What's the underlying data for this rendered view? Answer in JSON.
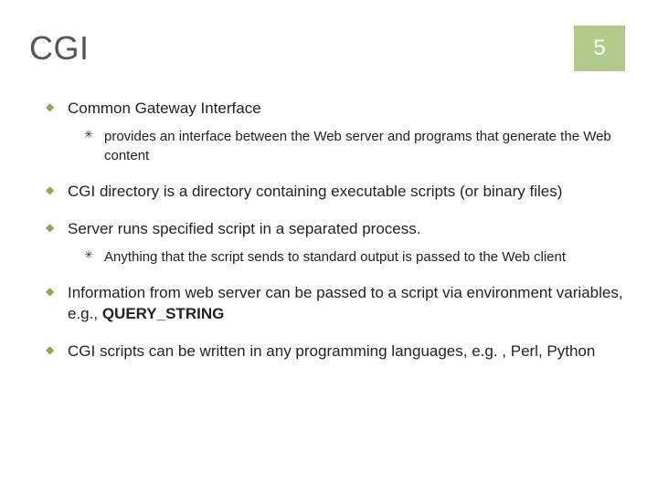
{
  "slide": {
    "title": "CGI",
    "page_number": "5",
    "bullets": [
      {
        "text": "Common Gateway Interface",
        "sub": [
          "provides an interface between the Web server and programs that generate the Web content"
        ]
      },
      {
        "text": "CGI directory is a directory containing executable scripts (or binary files)"
      },
      {
        "text": "Server runs specified script in a separated process.",
        "sub": [
          "Anything that the script sends to standard output is passed to the Web client"
        ]
      },
      {
        "text_pre": "Information from web server can be passed to a script via environment variables, e.g., ",
        "text_bold": "QUERY_STRING"
      },
      {
        "text": "CGI scripts can be written in any programming languages, e.g. , Perl, Python"
      }
    ]
  }
}
